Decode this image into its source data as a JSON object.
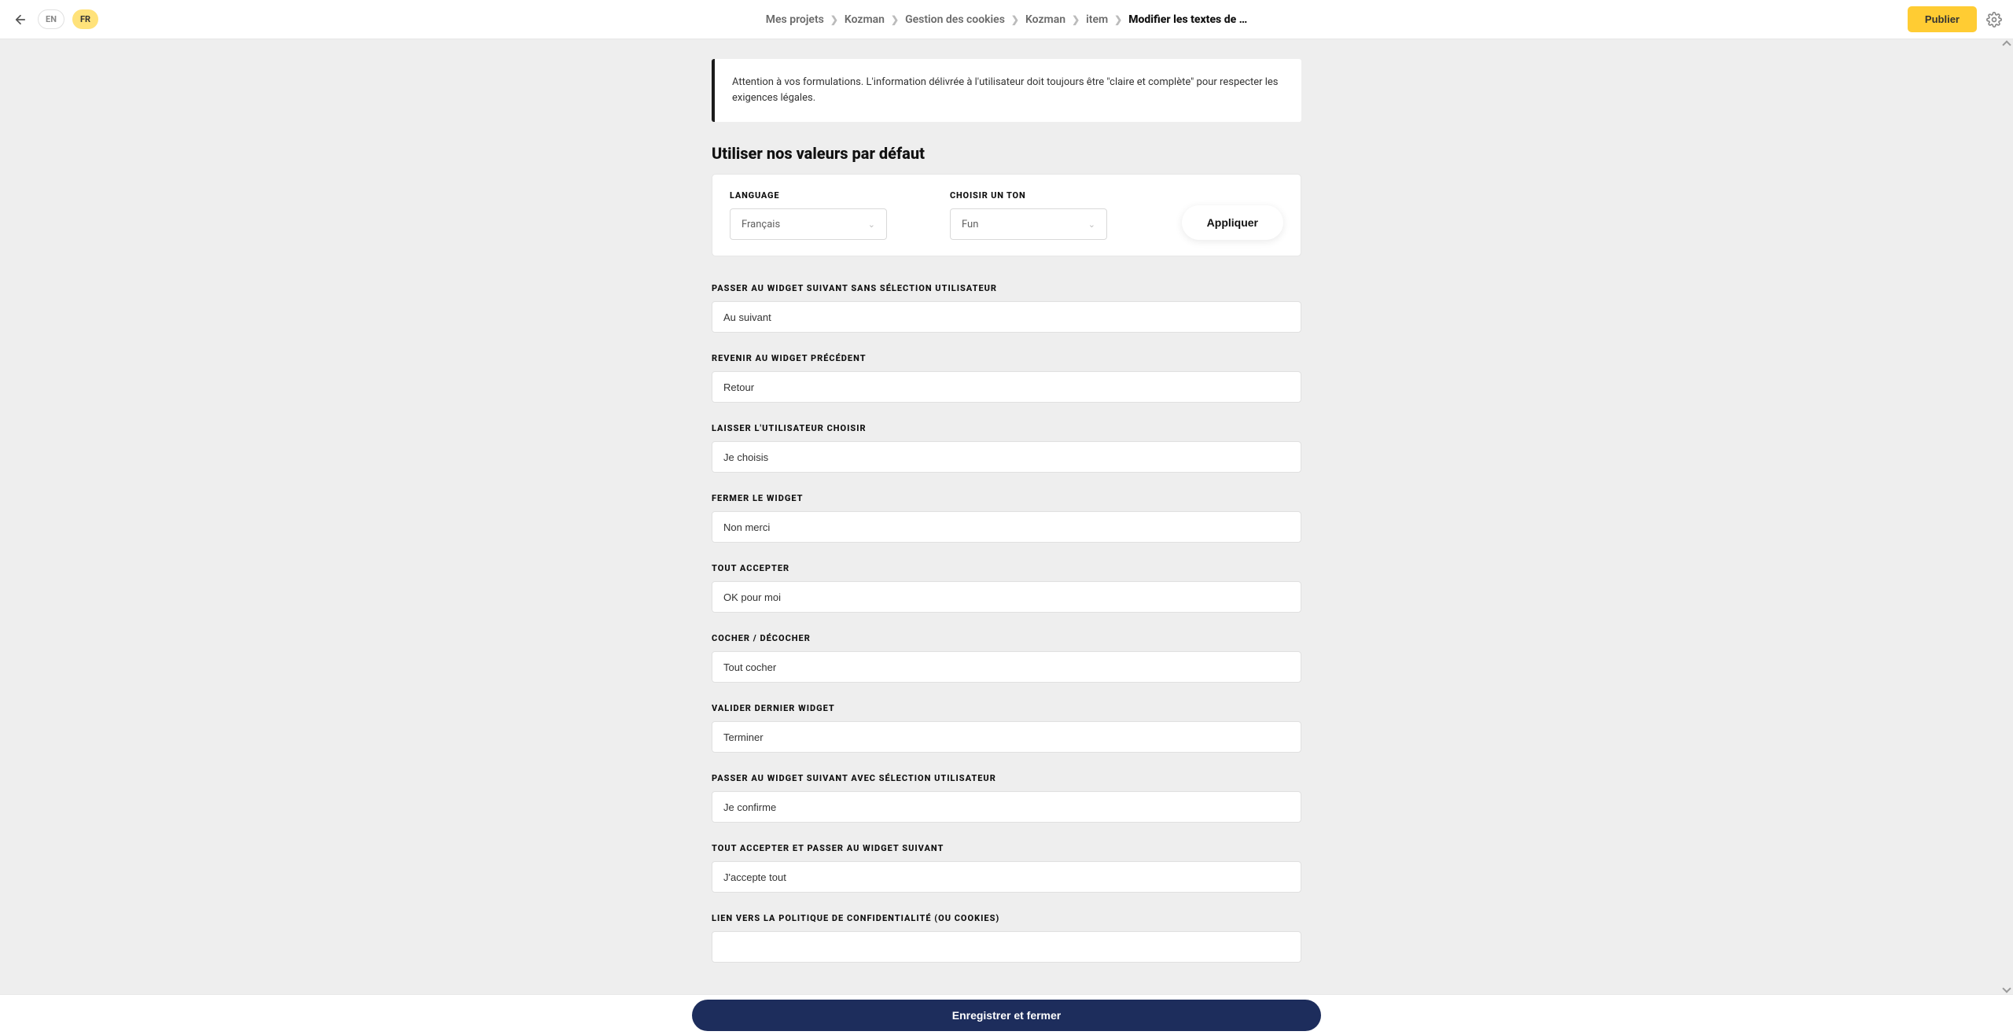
{
  "header": {
    "lang_en": "EN",
    "lang_fr": "FR",
    "breadcrumb": {
      "b0": "Mes projets",
      "b1": "Kozman",
      "b2": "Gestion des cookies",
      "b3": "Kozman",
      "b4": "item",
      "current": "Modifier les textes de …"
    },
    "publish": "Publier"
  },
  "alert": {
    "text": "Attention à vos formulations. L'information délivrée à l'utilisateur doit toujours être \"claire et complète\" pour respecter les exigences légales."
  },
  "defaults": {
    "title": "Utiliser nos valeurs par défaut",
    "language_label": "LANGUAGE",
    "language_value": "Français",
    "tone_label": "CHOISIR UN TON",
    "tone_value": "Fun",
    "apply": "Appliquer"
  },
  "fields": {
    "f0": {
      "label": "PASSER AU WIDGET SUIVANT SANS SÉLECTION UTILISATEUR",
      "value": "Au suivant"
    },
    "f1": {
      "label": "REVENIR AU WIDGET PRÉCÉDENT",
      "value": "Retour"
    },
    "f2": {
      "label": "LAISSER L'UTILISATEUR CHOISIR",
      "value": "Je choisis"
    },
    "f3": {
      "label": "FERMER LE WIDGET",
      "value": "Non merci"
    },
    "f4": {
      "label": "TOUT ACCEPTER",
      "value": "OK pour moi"
    },
    "f5": {
      "label": "COCHER / DÉCOCHER",
      "value": "Tout cocher"
    },
    "f6": {
      "label": "VALIDER DERNIER WIDGET",
      "value": "Terminer"
    },
    "f7": {
      "label": "PASSER AU WIDGET SUIVANT AVEC SÉLECTION UTILISATEUR",
      "value": "Je confirme"
    },
    "f8": {
      "label": "TOUT ACCEPTER ET PASSER AU WIDGET SUIVANT",
      "value": "J'accepte tout"
    },
    "f9": {
      "label": "LIEN VERS LA POLITIQUE DE CONFIDENTIALITÉ (OU COOKIES)",
      "value": ""
    }
  },
  "footer": {
    "save_close": "Enregistrer et fermer"
  }
}
